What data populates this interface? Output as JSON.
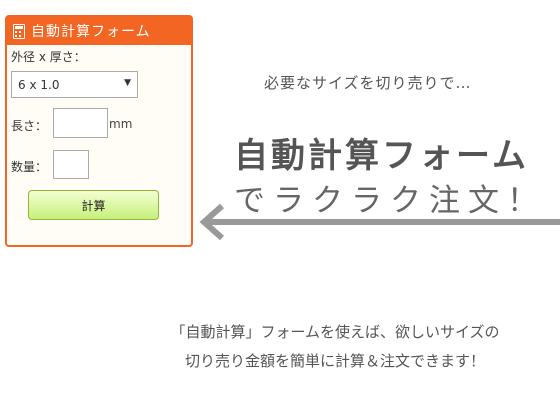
{
  "form": {
    "title": "自動計算フォーム",
    "header_icon": "calculator-icon",
    "size_label": "外径 x 厚さ：",
    "size_selected": "6 x 1.0",
    "length_label": "長さ：",
    "length_value": "",
    "length_unit": "mm",
    "quantity_label": "数量：",
    "quantity_value": "",
    "calc_button": "計算"
  },
  "promo": {
    "tagline": "必要なサイズを切り売りで…",
    "headline": "自動計算フォーム",
    "subline": "でラクラク注文！",
    "description_line1": "「自動計算」フォームを使えば、欲しいサイズの",
    "description_line2": "切り売り金額を簡単に計算＆注文できます！"
  },
  "colors": {
    "accent": "#f26522",
    "button": "#c6f07c",
    "arrow": "#999999"
  }
}
